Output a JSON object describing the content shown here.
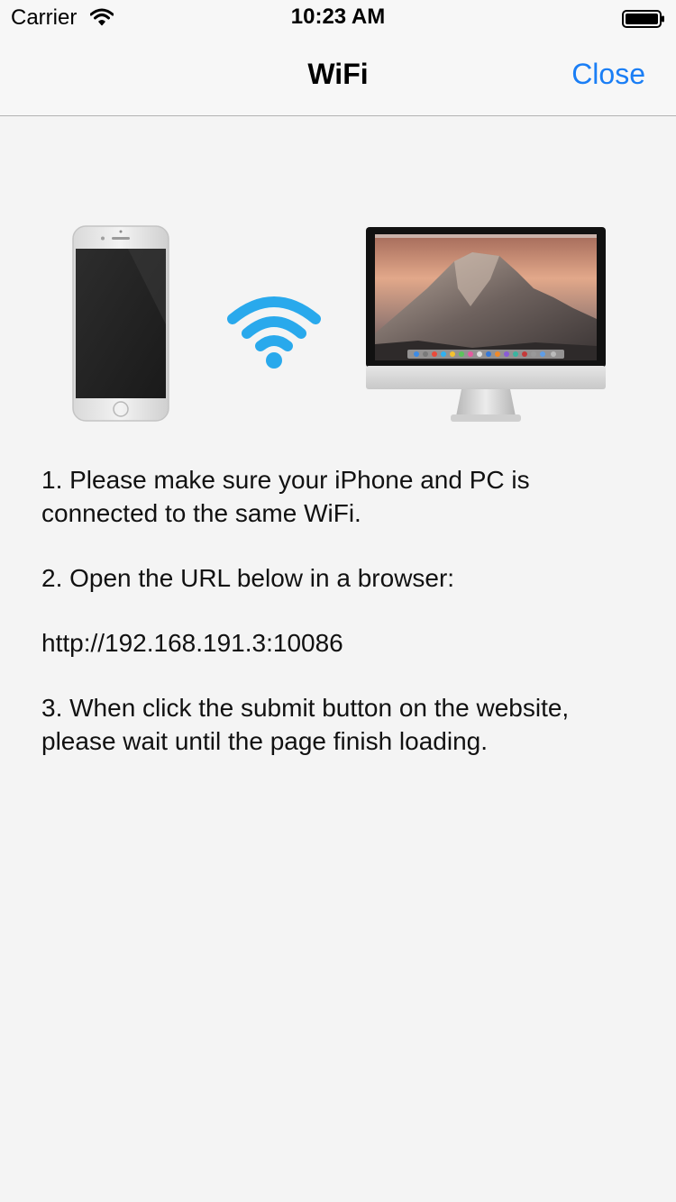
{
  "status_bar": {
    "carrier": "Carrier",
    "time": "10:23 AM",
    "wifi_icon": "wifi-signal-icon",
    "battery_icon": "battery-full-icon"
  },
  "nav": {
    "title": "WiFi",
    "close_label": "Close"
  },
  "illustration": {
    "phone": "iphone-image",
    "wifi": "wifi-icon",
    "monitor": "imac-image",
    "wifi_color": "#29a9ec"
  },
  "instructions": {
    "step1": "1. Please make sure your iPhone and PC is connected to the same WiFi.",
    "step2": "2. Open the URL below in a browser:",
    "url": "http://192.168.191.3:10086",
    "step3": "3. When click the submit button on the website, please wait until the page finish loading."
  },
  "colors": {
    "accent": "#1a7ef5",
    "background": "#f4f4f4"
  }
}
